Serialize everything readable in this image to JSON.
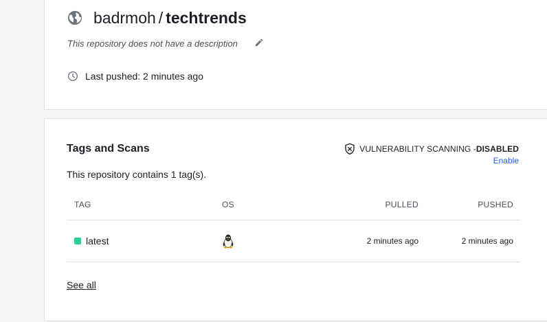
{
  "repo": {
    "namespace": "badrmoh",
    "separator": "/",
    "name": "techtrends",
    "description": "This repository does not have a description",
    "last_pushed": "Last pushed: 2 minutes ago"
  },
  "tags_section": {
    "title": "Tags and Scans",
    "vuln_label": "VULNERABILITY SCANNING - ",
    "vuln_status": "DISABLED",
    "enable_link": "Enable",
    "contains_text": "This repository contains 1 tag(s).",
    "columns": {
      "tag": "TAG",
      "os": "OS",
      "pulled": "PULLED",
      "pushed": "PUSHED"
    },
    "rows": [
      {
        "tag": "latest",
        "os": "linux-icon",
        "pulled": "2 minutes ago",
        "pushed": "2 minutes ago"
      }
    ],
    "see_all": "See all"
  },
  "colors": {
    "accent_link": "#1d63ed",
    "tag_status": "#2dcd98",
    "background": "#f5f5f5"
  }
}
